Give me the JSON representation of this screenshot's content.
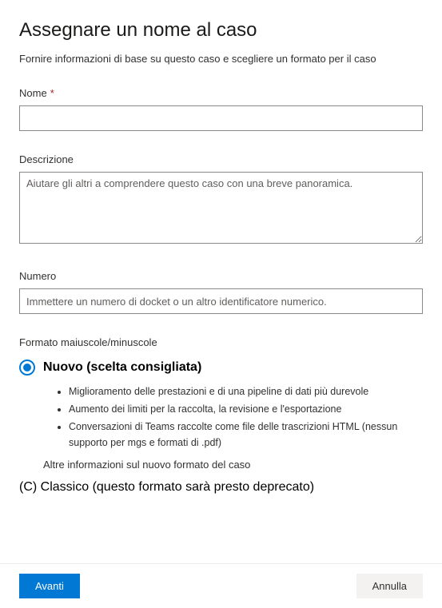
{
  "header": {
    "title": "Assegnare un nome al caso",
    "subtitle": "Fornire informazioni di base su questo caso e scegliere un formato per il caso"
  },
  "fields": {
    "name": {
      "label": "Nome",
      "required_marker": "*",
      "value": ""
    },
    "description": {
      "label": "Descrizione",
      "placeholder": "Aiutare gli altri a comprendere questo caso con una breve panoramica.",
      "value": ""
    },
    "number": {
      "label": "Numero",
      "placeholder": "Immettere un numero di docket o un altro identificatore numerico.",
      "value": ""
    }
  },
  "format": {
    "section_label": "Formato maiuscole/minuscole",
    "options": {
      "new": {
        "label": "Nuovo (scelta consigliata)",
        "selected": true,
        "bullets": [
          "Miglioramento delle prestazioni e di una pipeline di dati più durevole",
          "Aumento dei limiti per la raccolta, la revisione e l'esportazione",
          "Conversazioni di Teams raccolte come file delle trascrizioni HTML (nessun supporto per mgs e formati di .pdf)"
        ],
        "more_info": "Altre informazioni sul nuovo formato del caso"
      },
      "classic": {
        "label": "(C) Classico (questo formato sarà presto deprecato)",
        "selected": false
      }
    }
  },
  "footer": {
    "primary": "Avanti",
    "secondary": "Annulla"
  }
}
